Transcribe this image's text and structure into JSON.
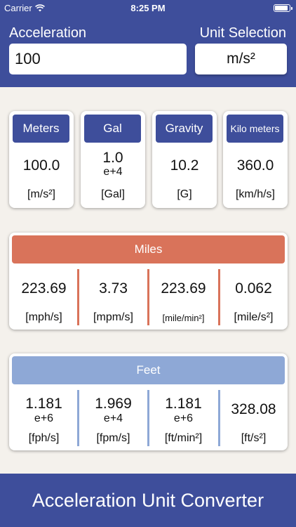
{
  "status": {
    "carrier": "Carrier",
    "time": "8:25 PM"
  },
  "header": {
    "acceleration_label": "Acceleration",
    "unit_selection_label": "Unit Selection",
    "input_value": "100",
    "unit_value": "m/s²"
  },
  "cards": [
    {
      "title": "Meters",
      "value": "100.0",
      "exp": "",
      "unit": "[m/s²]"
    },
    {
      "title": "Gal",
      "value": "1.0",
      "exp": "e+4",
      "unit": "[Gal]"
    },
    {
      "title": "Gravity",
      "value": "10.2",
      "exp": "",
      "unit": "[G]"
    },
    {
      "title": "Kilo meters",
      "value": "360.0",
      "exp": "",
      "unit": "[km/h/s]"
    }
  ],
  "miles": {
    "title": "Miles",
    "color": "#d9735a",
    "cells": [
      {
        "value": "223.69",
        "exp": "",
        "unit": "[mph/s]"
      },
      {
        "value": "3.73",
        "exp": "",
        "unit": "[mpm/s]"
      },
      {
        "value": "223.69",
        "exp": "",
        "unit": "[mile/min²]"
      },
      {
        "value": "0.062",
        "exp": "",
        "unit": "[mile/s²]"
      }
    ]
  },
  "feet": {
    "title": "Feet",
    "color": "#8ea8d6",
    "cells": [
      {
        "value": "1.181",
        "exp": "e+6",
        "unit": "[fph/s]"
      },
      {
        "value": "1.969",
        "exp": "e+4",
        "unit": "[fpm/s]"
      },
      {
        "value": "1.181",
        "exp": "e+6",
        "unit": "[ft/min²]"
      },
      {
        "value": "328.08",
        "exp": "",
        "unit": "[ft/s²]"
      }
    ]
  },
  "footer": {
    "title": "Acceleration Unit Converter"
  },
  "colors": {
    "primary": "#3e4e9b",
    "background": "#f4f1ec"
  }
}
